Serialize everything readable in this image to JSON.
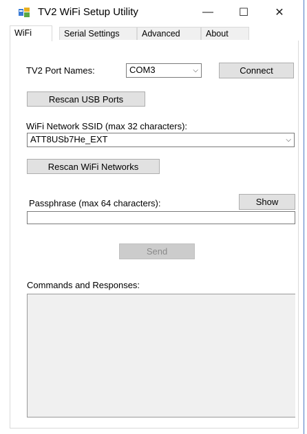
{
  "window": {
    "title": "TV2 WiFi Setup Utility",
    "icon": "wifi-app-icon",
    "minimize_glyph": "—",
    "maximize_glyph": "☐",
    "close_glyph": "✕",
    "accent_color": "#4a78c2"
  },
  "tabs": [
    {
      "label": "WiFi",
      "active": true
    },
    {
      "label": "Serial Settings",
      "active": false
    },
    {
      "label": "Advanced",
      "active": false
    },
    {
      "label": "About",
      "active": false
    }
  ],
  "wifi_tab": {
    "port_names_label": "TV2 Port Names:",
    "port_value": "COM3",
    "connect_button": "Connect",
    "rescan_usb_button": "Rescan USB Ports",
    "ssid_label": "WiFi Network SSID (max 32 characters):",
    "ssid_value": "ATT8USb7He_EXT",
    "rescan_wifi_button": "Rescan WiFi Networks",
    "passphrase_label": "Passphrase (max 64 characters):",
    "show_button": "Show",
    "passphrase_value": "",
    "send_button": "Send",
    "log_label": "Commands and Responses:",
    "log_value": ""
  },
  "dropdown_arrow": "⌵"
}
